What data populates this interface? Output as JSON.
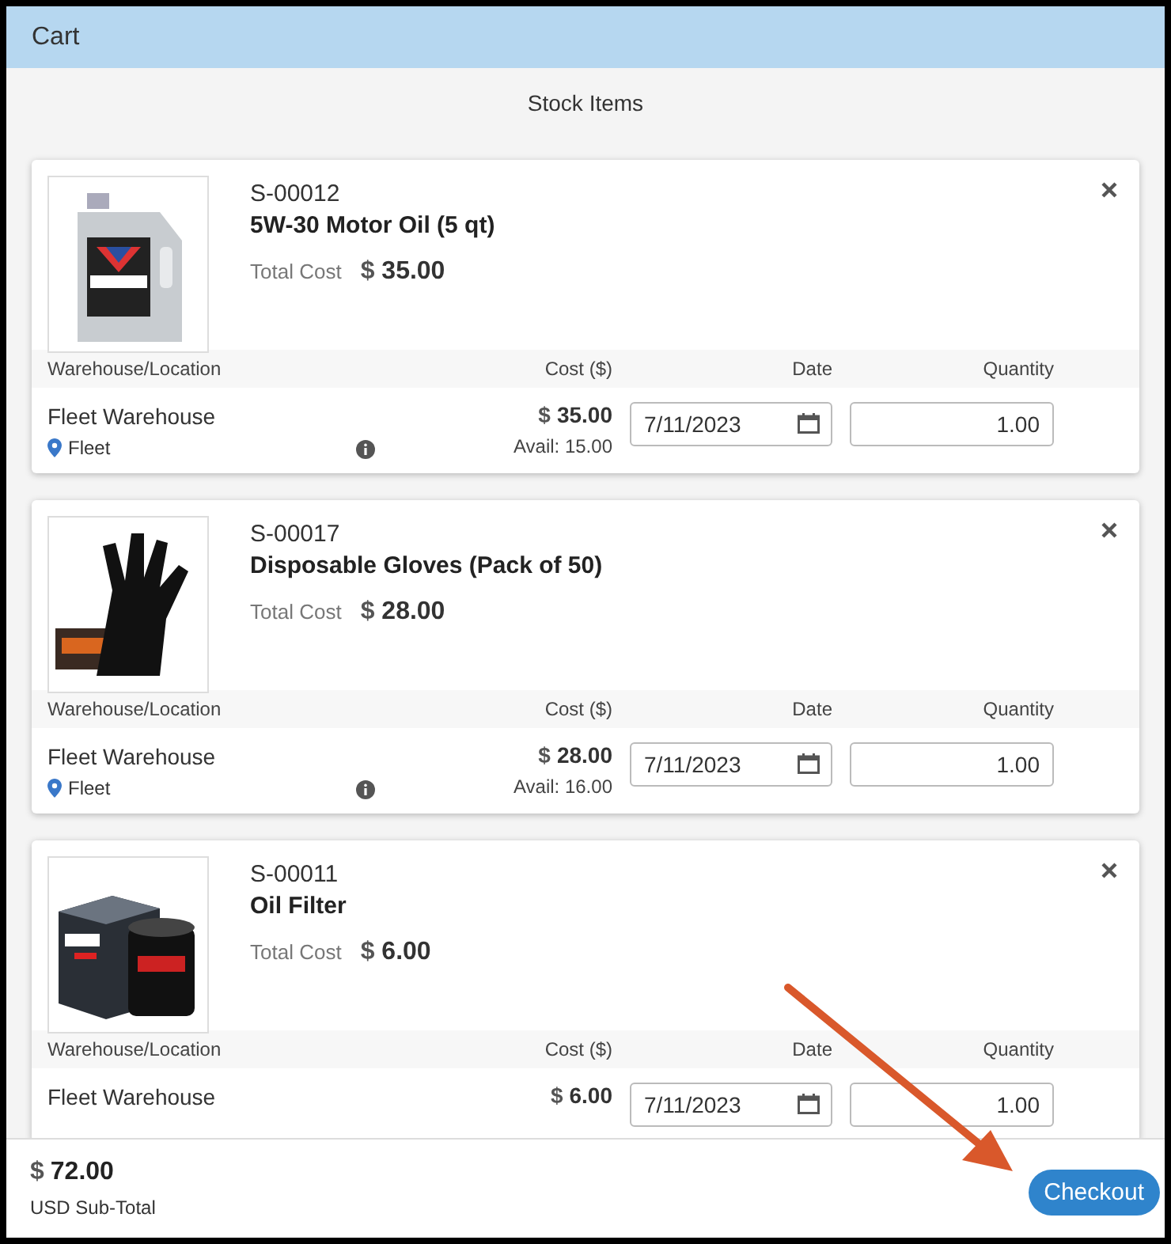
{
  "window": {
    "title": "Cart"
  },
  "section_title": "Stock Items",
  "items": [
    {
      "sku": "S-00012",
      "name": "5W-30 Motor Oil (5 qt)",
      "total_label": "Total Cost",
      "currency": "$",
      "total": "35.00",
      "columns": [
        "Warehouse/Location",
        "Cost ($)",
        "Date",
        "Quantity"
      ],
      "warehouse": "Fleet Warehouse",
      "location": "Fleet",
      "cost": "35.00",
      "avail": "Avail: 15.00",
      "date": "7/11/2023",
      "quantity": "1.00"
    },
    {
      "sku": "S-00017",
      "name": "Disposable Gloves (Pack of 50)",
      "total_label": "Total Cost",
      "currency": "$",
      "total": "28.00",
      "columns": [
        "Warehouse/Location",
        "Cost ($)",
        "Date",
        "Quantity"
      ],
      "warehouse": "Fleet Warehouse",
      "location": "Fleet",
      "cost": "28.00",
      "avail": "Avail: 16.00",
      "date": "7/11/2023",
      "quantity": "1.00"
    },
    {
      "sku": "S-00011",
      "name": "Oil Filter",
      "total_label": "Total Cost",
      "currency": "$",
      "total": "6.00",
      "columns": [
        "Warehouse/Location",
        "Cost ($)",
        "Date",
        "Quantity"
      ],
      "warehouse": "Fleet Warehouse",
      "cost": "6.00",
      "date": "7/11/2023",
      "quantity": "1.00"
    }
  ],
  "footer": {
    "currency": "$",
    "subtotal": "72.00",
    "subtotal_label": "USD Sub-Total",
    "checkout": "Checkout"
  }
}
